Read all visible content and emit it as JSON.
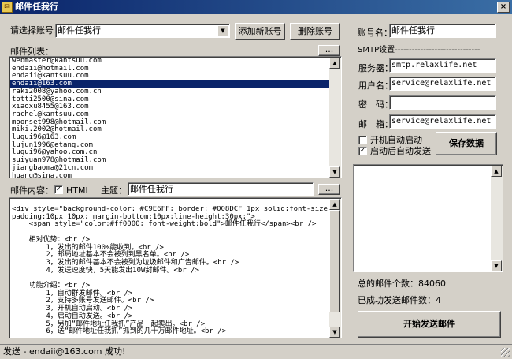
{
  "window": {
    "title": "邮件任我行",
    "close_glyph": "×",
    "app_icon_glyph": "✉"
  },
  "account": {
    "select_label": "请选择账号：",
    "selected": "邮件任我行",
    "add_button": "添加新账号",
    "delete_button": "删除账号"
  },
  "mail_list": {
    "label": "邮件列表：",
    "more_button": "...",
    "items": [
      "webmaster@kantsuu.com",
      "endaii@hotmail.com",
      "endaii@kantsuu.com",
      "endaii@163.com",
      "raki2008@yahoo.com.cn",
      "totti2500@sina.com",
      "xiaoxu8455@163.com",
      "rachel@kantsuu.com",
      "moonset998@hotmail.com",
      "miki.2002@hotmail.com",
      "lugui96@163.com",
      "lujun1996@etang.com",
      "lugui96@yahoo.com.cn",
      "suiyuan978@hotmail.com",
      "jiangbaoma@21cn.com",
      "huang@sina.com"
    ],
    "selected_index": 3
  },
  "content": {
    "label": "邮件内容：",
    "html_checkbox_label": "HTML",
    "html_checked": true,
    "subject_label": "主题：",
    "subject_value": "邮件任我行",
    "more_button": "...",
    "body_lines": [
      "<div style=\"background-color: #C9E6FF; border: #008DCF 1px solid;font-size:14px;",
      "padding:10px 10px; margin-bottom:10px;line-height:30px;\">",
      "    <span style=\"color:#ff0000; font-weight:bold\">邮件任我行</span><br />",
      "",
      "    相对优势：<br />",
      "        1，发出的邮件100%能收到。<br />",
      "        2，邮局地址基本不会被列到黑名单。<br />",
      "        3，发出的邮件基本不会被列为垃圾邮件和广告邮件。<br />",
      "        4，发送速度快，5天能发出10W封邮件。<br />",
      "",
      "    功能介绍：<br />",
      "        1，自动群发邮件。<br />",
      "        2，支持多账号发送邮件。<br />",
      "        3，开机自动启动。<br />",
      "        4，启动自动发送。<br />",
      "        5，另加“邮件地址任我抓”产品一起卖出。<br />",
      "        6，送“邮件地址任我抓”抓到的几十万邮件地址。<br />"
    ]
  },
  "settings": {
    "account_name_label": "账号名：",
    "account_name_value": "邮件任我行",
    "smtp_header": "SMTP设置------------------------------",
    "server_label": "服务器：",
    "server_value": "smtp.relaxlife.net",
    "username_label": "用户名：",
    "username_value": "service@relaxlife.net",
    "password_label": "密　码：",
    "password_value": "",
    "email_label": "邮　箱：",
    "email_value": "service@relaxlife.net",
    "autostart_label": "开机自动启动",
    "autostart_checked": false,
    "autosend_label": "启动后自动发送",
    "autosend_checked": true,
    "save_button": "保存数据"
  },
  "stats": {
    "total_label": "总的邮件个数：84060",
    "sent_label": "已成功发送邮件数：4",
    "start_button": "开始发送邮件"
  },
  "status": {
    "text": "发送 - endaii@163.com 成功!"
  },
  "glyphs": {
    "up": "▲",
    "down": "▼",
    "check": "✓"
  },
  "colors": {
    "title_start": "#0a246a",
    "title_end": "#3a6ea5",
    "selection": "#0a246a",
    "face": "#d4d0c8"
  }
}
